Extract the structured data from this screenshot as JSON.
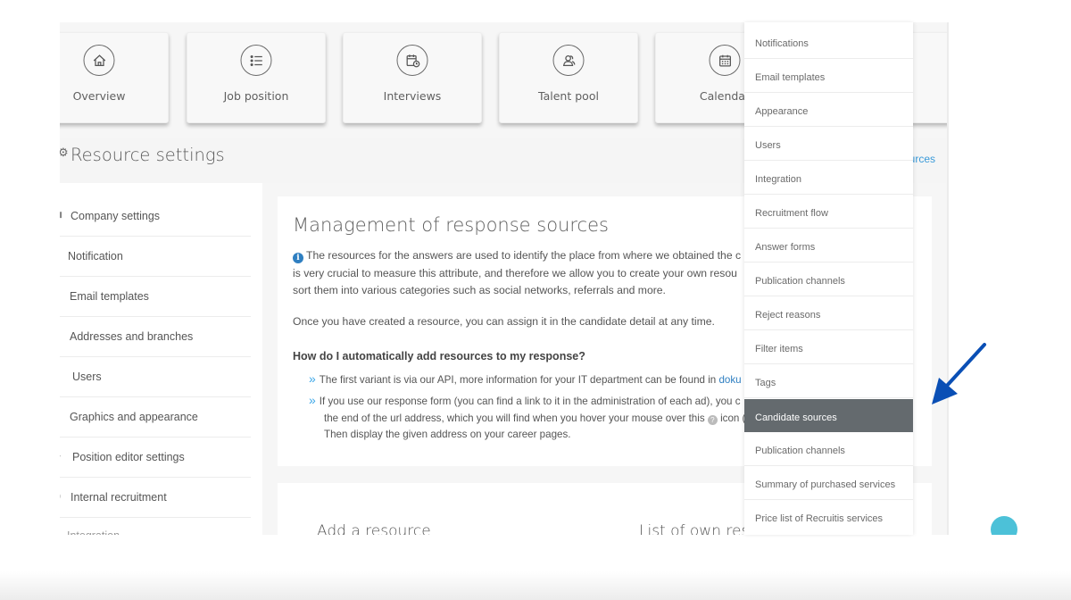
{
  "tiles": [
    {
      "label": "Overview",
      "icon": "home-icon"
    },
    {
      "label": "Job position",
      "icon": "list-icon"
    },
    {
      "label": "Interviews",
      "icon": "calendar-clock-icon"
    },
    {
      "label": "Talent pool",
      "icon": "users-icon"
    },
    {
      "label": "Calendar",
      "icon": "calendar-icon"
    }
  ],
  "header": {
    "title": "Resource settings",
    "link_partial": "urces"
  },
  "sidebar": {
    "items": [
      {
        "label": "Company settings"
      },
      {
        "label": "Notification"
      },
      {
        "label": "Email templates"
      },
      {
        "label": "Addresses and branches"
      },
      {
        "label": "Users"
      },
      {
        "label": "Graphics and appearance"
      },
      {
        "label": "Position editor settings"
      },
      {
        "label": "Internal recruitment"
      },
      {
        "label": "Integration"
      }
    ]
  },
  "main": {
    "title": "Management of response sources",
    "intro_line1": "The resources for the answers are used to identify the place from where we obtained the c",
    "intro_line2": "is very crucial to measure this attribute, and therefore we allow you to create your own resou",
    "intro_line3": "sort them into various categories such as social networks, referrals and more.",
    "assign_text": "Once you have created a resource, you can assign it in the candidate detail at any time.",
    "howto_heading": "How do I automatically add resources to my response?",
    "bullet1_text": "The first variant is via our API, more information for your IT department can be found in ",
    "bullet1_link": "doku",
    "bullet2_line1": "If you use our response form (you can find a link to it in the administration of each ad), you c",
    "bullet2_line2a": "the end of the url address, which you will find when you hover your mouse over this ",
    "bullet2_line2b": " icon (",
    "bullet2_line3": "Then display the given address on your career pages.",
    "add_resource_heading": "Add a resource",
    "list_heading": "List of own res"
  },
  "dropdown": {
    "active_index": 11,
    "items": [
      {
        "label": "Notifications"
      },
      {
        "label": "Email templates"
      },
      {
        "label": "Appearance"
      },
      {
        "label": "Users"
      },
      {
        "label": "Integration"
      },
      {
        "label": "Recruitment flow"
      },
      {
        "label": "Answer forms"
      },
      {
        "label": "Publication channels"
      },
      {
        "label": "Reject reasons"
      },
      {
        "label": "Filter items"
      },
      {
        "label": "Tags"
      },
      {
        "label": "Candidate sources"
      },
      {
        "label": "Publication channels"
      },
      {
        "label": "Summary of purchased services"
      },
      {
        "label": "Price list of Recruitis services"
      }
    ]
  },
  "colors": {
    "accent_link": "#3a9ad9",
    "active_menu_bg": "#646a6e",
    "annotation_arrow": "#0a4fb5",
    "info_icon": "#2f7fc1"
  }
}
